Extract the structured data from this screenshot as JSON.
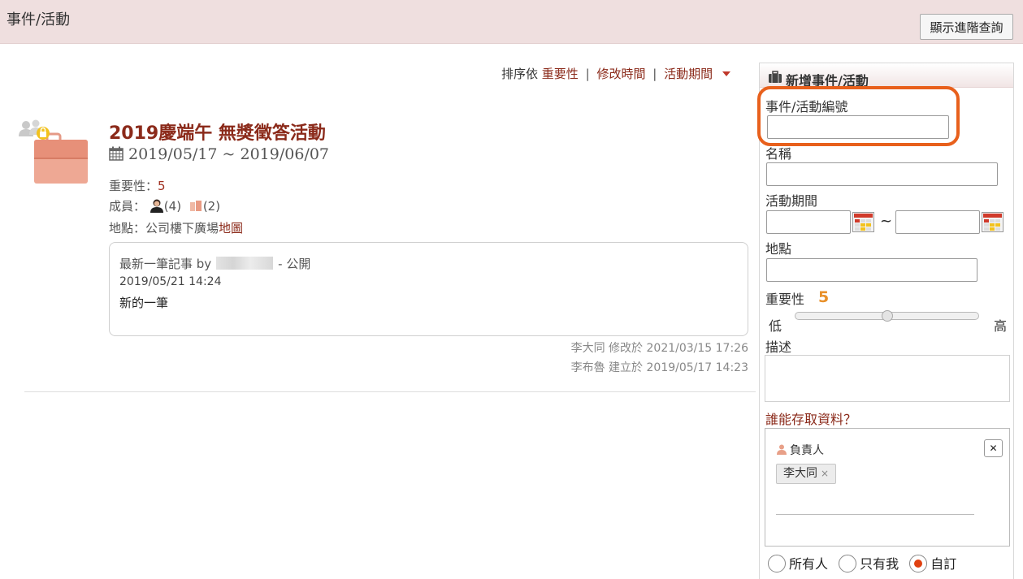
{
  "header": {
    "title": "事件/活動",
    "advanced_button": "顯示進階查詢"
  },
  "sort": {
    "prefix": "排序依",
    "options": [
      "重要性",
      "修改時間",
      "活動期間"
    ],
    "separator": "|"
  },
  "event": {
    "title": "2019慶端午 無獎徵答活動",
    "dates": "2019/05/17 ~ 2019/06/07",
    "importance_label": "重要性：",
    "importance_value": "5",
    "members_label": "成員：",
    "members_people": "(4)",
    "members_groups": "(2)",
    "location_label": "地點：",
    "location_value": "公司樓下廣場",
    "map_link": "地圖",
    "note": {
      "header_prefix": "最新一筆記事 by",
      "visibility": "- 公開",
      "time": "2019/05/21 14:24",
      "content": "新的一筆"
    },
    "modified": "李大同 修改於 2021/03/15 17:26",
    "created": "李布魯 建立於 2019/05/17 14:23"
  },
  "panel": {
    "title": "新增事件/活動",
    "id_label": "事件/活動編號",
    "name_label": "名稱",
    "period_label": "活動期間",
    "tilde": "~",
    "location_label": "地點",
    "importance_label": "重要性",
    "importance_value": "5",
    "importance_fraction": 0.5,
    "low": "低",
    "high": "高",
    "desc_label": "描述",
    "access_link": "誰能存取資料？",
    "owner_label": "負責人",
    "close": "✕",
    "owner_chip": "李大同",
    "chip_remove": "×",
    "radio_options": [
      "所有人",
      "只有我",
      "自訂"
    ],
    "radio_selected": 2
  },
  "colors": {
    "accent": "#8b2a1a",
    "highlight": "#e8601c",
    "importance": "#e8902a",
    "radio_on": "#e04010"
  }
}
